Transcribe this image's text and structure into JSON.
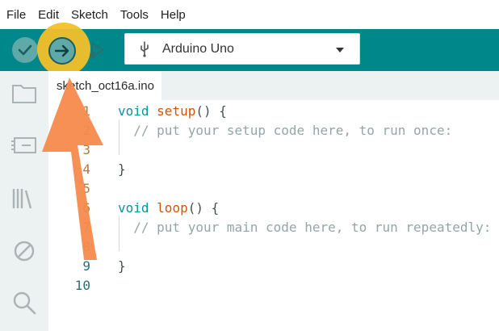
{
  "menu": {
    "items": [
      "File",
      "Edit",
      "Sketch",
      "Tools",
      "Help"
    ]
  },
  "toolbar": {
    "board": "Arduino Uno",
    "verify_icon": "checkmark-icon",
    "upload_icon": "arrow-right-icon",
    "debug_icon": "debug-icon",
    "accent": "#00878a"
  },
  "tab": {
    "filename": "sketch_oct16a.ino"
  },
  "editor": {
    "line_numbers": [
      "1",
      "2",
      "3",
      "4",
      "5",
      "6",
      "7",
      "8",
      "9",
      "10"
    ],
    "lines": {
      "l1_kw": "void",
      "l1_fn": "setup",
      "l1_rest": "() {",
      "l2_cm": "  // put your setup code here, to run once:",
      "l4": "}",
      "l6_kw": "void",
      "l6_fn": "loop",
      "l6_rest": "() {",
      "l7_cm": "  // put your main code here, to run repeatedly:",
      "l9": "}"
    }
  },
  "annotation": {
    "highlight_color": "#f2c029",
    "arrow_color": "#f58a4b"
  }
}
